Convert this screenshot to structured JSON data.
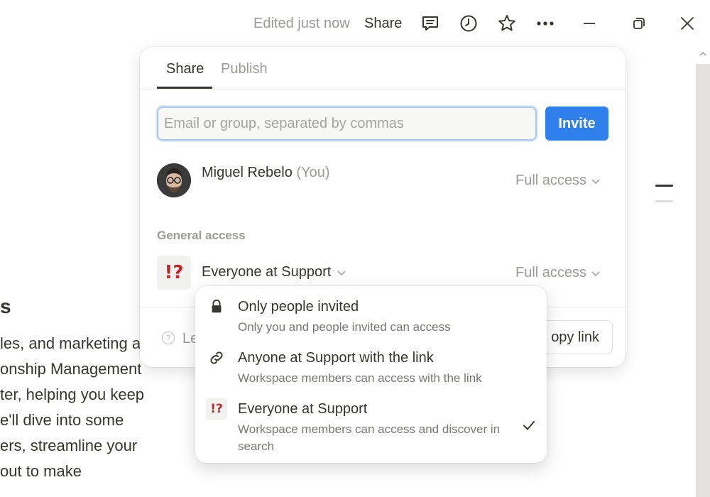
{
  "topbar": {
    "edited": "Edited just now",
    "share": "Share",
    "icons": [
      "comments-icon",
      "history-icon",
      "star-icon",
      "more-icon",
      "minimize-icon",
      "restore-icon",
      "close-icon"
    ]
  },
  "document": {
    "heading_fragment": "s",
    "lines": [
      "les, and marketing a",
      "onship Management",
      "ter, helping you keep",
      "e'll dive into some",
      "ers, streamline your",
      "out to make"
    ]
  },
  "share_panel": {
    "tabs": [
      {
        "label": "Share",
        "active": true
      },
      {
        "label": "Publish",
        "active": false
      }
    ],
    "invite_placeholder": "Email or group, separated by commas",
    "invite_value": "",
    "invite_button": "Invite",
    "user": {
      "name": "Miguel Rebelo",
      "you_label": "(You)",
      "access": "Full access"
    },
    "general_access_label": "General access",
    "workspace": {
      "icon_glyph": "!?",
      "name": "Everyone at Support",
      "access": "Full access"
    },
    "footer": {
      "learn_text": "Le",
      "copy_link": "opy link"
    }
  },
  "access_menu": {
    "items": [
      {
        "icon": "lock-icon",
        "title": "Only people invited",
        "description": "Only you and people invited can access",
        "selected": false
      },
      {
        "icon": "link-icon",
        "title": "Anyone at Support with the link",
        "description": "Workspace members can access with the link",
        "selected": false
      },
      {
        "icon": "workspace-icon",
        "icon_glyph": "!?",
        "title": "Everyone at Support",
        "description": "Workspace members can access and discover in search",
        "selected": true
      }
    ]
  },
  "colors": {
    "accent": "#2f80ed",
    "text": "#37352f",
    "muted": "#9b9a97",
    "workspace_icon": "#c2262e"
  }
}
